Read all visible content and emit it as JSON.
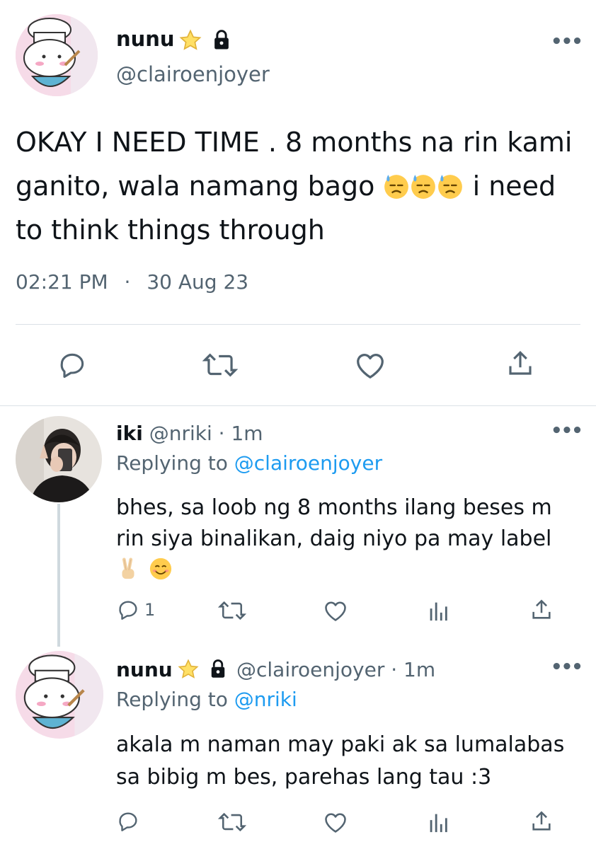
{
  "main_tweet": {
    "display_name": "nunu",
    "handle": "@clairoenjoyer",
    "text_line1": "OKAY I NEED TIME . 8 months na rin kami",
    "text_line2_a": "ganito, wala namang bago",
    "text_line2_b": "i need",
    "text_line3": "to think things through",
    "time": "02:21 PM",
    "separator": "·",
    "date": "30 Aug 23"
  },
  "reply1": {
    "display_name": "iki",
    "handle": "@nriki",
    "time": "· 1m",
    "replying_label": "Replying to",
    "replying_handle": "@clairoenjoyer",
    "text_line1": "bhes, sa loob ng 8 months ilang beses m",
    "text_line2": "rin siya binalikan, daig niyo pa may label",
    "reply_count": "1"
  },
  "reply2": {
    "display_name": "nunu",
    "handle": "@clairoenjoyer",
    "time": "· 1m",
    "replying_label": "Replying to",
    "replying_handle": "@nriki",
    "text_line1": "akala m naman may paki ak sa lumalabas",
    "text_line2": "sa bibig m bes, parehas lang tau :3"
  },
  "icons": [
    "star-icon",
    "lock-icon",
    "more-icon",
    "reply-icon",
    "retweet-icon",
    "like-icon",
    "share-icon",
    "analytics-icon",
    "sweat-emoji-icon",
    "victory-hand-emoji-icon",
    "smile-emoji-icon"
  ],
  "colors": {
    "text": "#0f1419",
    "secondary": "#536471",
    "link": "#1d9bf0",
    "divider": "#dbe1e6"
  }
}
